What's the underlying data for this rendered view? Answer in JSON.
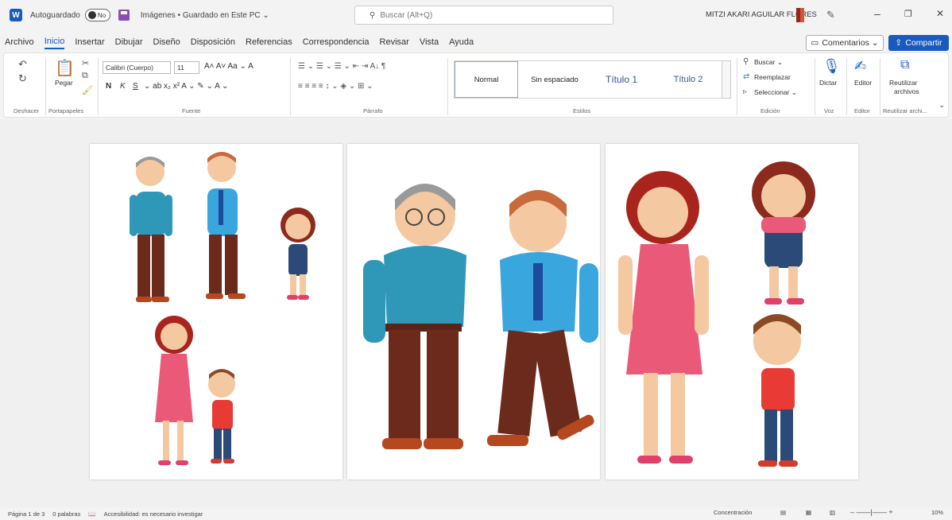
{
  "titlebar": {
    "autosave_label": "Autoguardado",
    "toggle_state": "No",
    "doc_title": "Imágenes • Guardado en Este PC ⌄",
    "search_placeholder": "Buscar (Alt+Q)",
    "user_name": "MITZI AKARI AGUILAR FLORES",
    "minimize": "–",
    "restore": "❐",
    "close": "✕"
  },
  "menu": {
    "tabs": [
      "Archivo",
      "Inicio",
      "Insertar",
      "Dibujar",
      "Diseño",
      "Disposición",
      "Referencias",
      "Correspondencia",
      "Revisar",
      "Vista",
      "Ayuda"
    ],
    "active_tab": "Inicio",
    "comments_label": "Comentarios ⌄",
    "share_label": "Compartir"
  },
  "ribbon": {
    "undo_group_label": "Deshacer",
    "clipboard_group_label": "Portapapeles",
    "paste_label": "Pegar",
    "font_name": "Calibri (Cuerpo)",
    "font_size": "11",
    "font_group_label": "Fuente",
    "font_row1": "A˄  A˅  Aa ⌄  A",
    "font_row2_bold": "N",
    "font_row2_italic": "K",
    "font_row2_underline": "S",
    "font_row2_rest": "⌄  ab  x₂  x²  A ⌄  ✎ ⌄  A ⌄",
    "paragraph_row1": "☰ ⌄  ☰ ⌄  ☰ ⌄   ⇤  ⇥   A↓   ¶",
    "paragraph_row2": "≡   ≡   ≡   ≡   ↕ ⌄   ◈ ⌄   ⊞ ⌄",
    "paragraph_group_label": "Párrafo",
    "styles": [
      "Normal",
      "Sin espaciado",
      "Título 1",
      "Título 2"
    ],
    "styles_group_label": "Estilos",
    "find_label": "Buscar ⌄",
    "replace_label": "Reemplazar",
    "select_label": "Seleccionar ⌄",
    "editing_group_label": "Edición",
    "dictate_label": "Dictar",
    "voice_group_label": "Voz",
    "editor_label": "Editor",
    "editor_group_label": "Editor",
    "reuse_label_1": "Reutilizar",
    "reuse_label_2": "archivos",
    "reuse_group_label": "Reutilizar archi..."
  },
  "statusbar": {
    "page": "Página 1 de 3",
    "words": "0 palabras",
    "accessibility": "Accesibilidad: es necesario investigar",
    "focus": "Concentración",
    "zoom": "10%"
  }
}
